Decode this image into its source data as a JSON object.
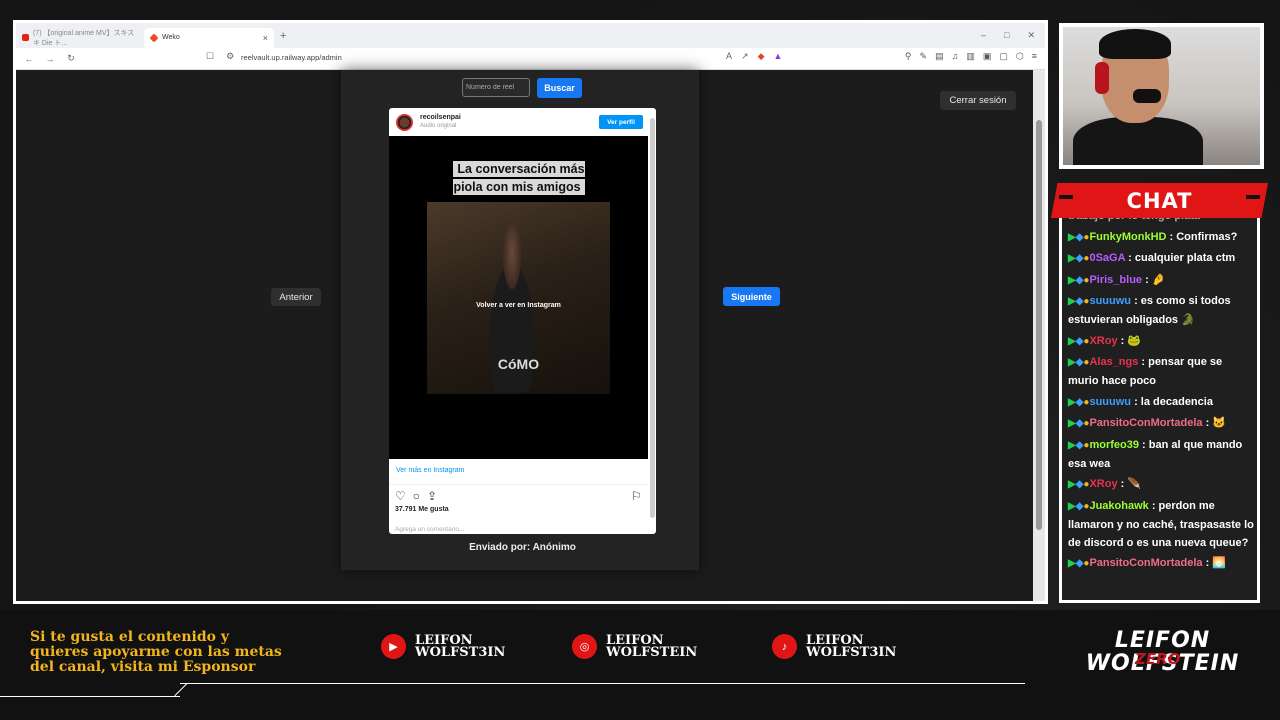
{
  "browser": {
    "tabs": [
      {
        "title": "(7) 【original anime MV】スキスキ Die ト...",
        "active": false
      },
      {
        "title": "Weko",
        "active": true
      }
    ],
    "url": "reelvault.up.railway.app/admin"
  },
  "page": {
    "search_placeholder": "Número de reel",
    "search_button": "Buscar",
    "logout_button": "Cerrar sesión",
    "prev_button": "Anterior",
    "next_button": "Siguiente",
    "sender": "Enviado por: Anónimo"
  },
  "instagram": {
    "username": "recoilsenpai",
    "audio": "Audio original",
    "profile_button": "Ver perfil",
    "caption": "La conversación más piola con mis amigos",
    "replay": "Volver a ver en Instagram",
    "overlay_word": "CóMO",
    "see_more": "Ver más en Instagram",
    "likes": "37.791 Me gusta",
    "comment_placeholder": "Agrega un comentario..."
  },
  "chat": {
    "title": "CHAT",
    "clipped_text": "trabajo por lo tengo plata",
    "messages": [
      {
        "user": "FunkyMonkHD",
        "color": "#9bff33",
        "text": "Confirmas?"
      },
      {
        "user": "0SaGA",
        "color": "#b85cff",
        "text": "cualquier plata ctm"
      },
      {
        "user": "Piris_blue",
        "color": "#b85cff",
        "text": "🤌"
      },
      {
        "user": "suuuwu",
        "color": "#3ba0ff",
        "text": "es como si todos estuvieran obligados 🐊"
      },
      {
        "user": "XRoy",
        "color": "#e8344b",
        "text": "🐸"
      },
      {
        "user": "Alas_ngs",
        "color": "#e8344b",
        "text": "pensar que se murio hace poco"
      },
      {
        "user": "suuuwu",
        "color": "#3ba0ff",
        "text": "la decadencia"
      },
      {
        "user": "PansitoConMortadela",
        "color": "#f06b8a",
        "text": "🐱"
      },
      {
        "user": "morfeo39",
        "color": "#9bff33",
        "text": "ban al que mando esa wea"
      },
      {
        "user": "XRoy",
        "color": "#e8344b",
        "text": "🪶"
      },
      {
        "user": "Juakohawk",
        "color": "#9bff33",
        "text": "perdon me llamaron y no caché, traspasaste lo de discord o es una nueva queue?"
      },
      {
        "user": "PansitoConMortadela",
        "color": "#f06b8a",
        "text": "🌅"
      }
    ]
  },
  "overlay": {
    "promo": "Si te gusta el contenido y quieres apoyarme con las metas del canal, visita mi Esponsor",
    "socials": [
      {
        "icon": "youtube-icon",
        "line1": "LEIFON",
        "line2": "WOLFST3IN"
      },
      {
        "icon": "instagram-icon",
        "line1": "LEIFON",
        "line2": "WOLFSTEIN"
      },
      {
        "icon": "tiktok-icon",
        "line1": "LEIFON",
        "line2": "WOLFST3IN"
      }
    ],
    "logo_line1": "LEIFON",
    "logo_line2": "WOLFSTEIN",
    "logo_accent": "ZERO"
  },
  "colors": {
    "accent_red": "#e01515",
    "accent_gold": "#f2b51c",
    "button_blue": "#1877f2"
  }
}
